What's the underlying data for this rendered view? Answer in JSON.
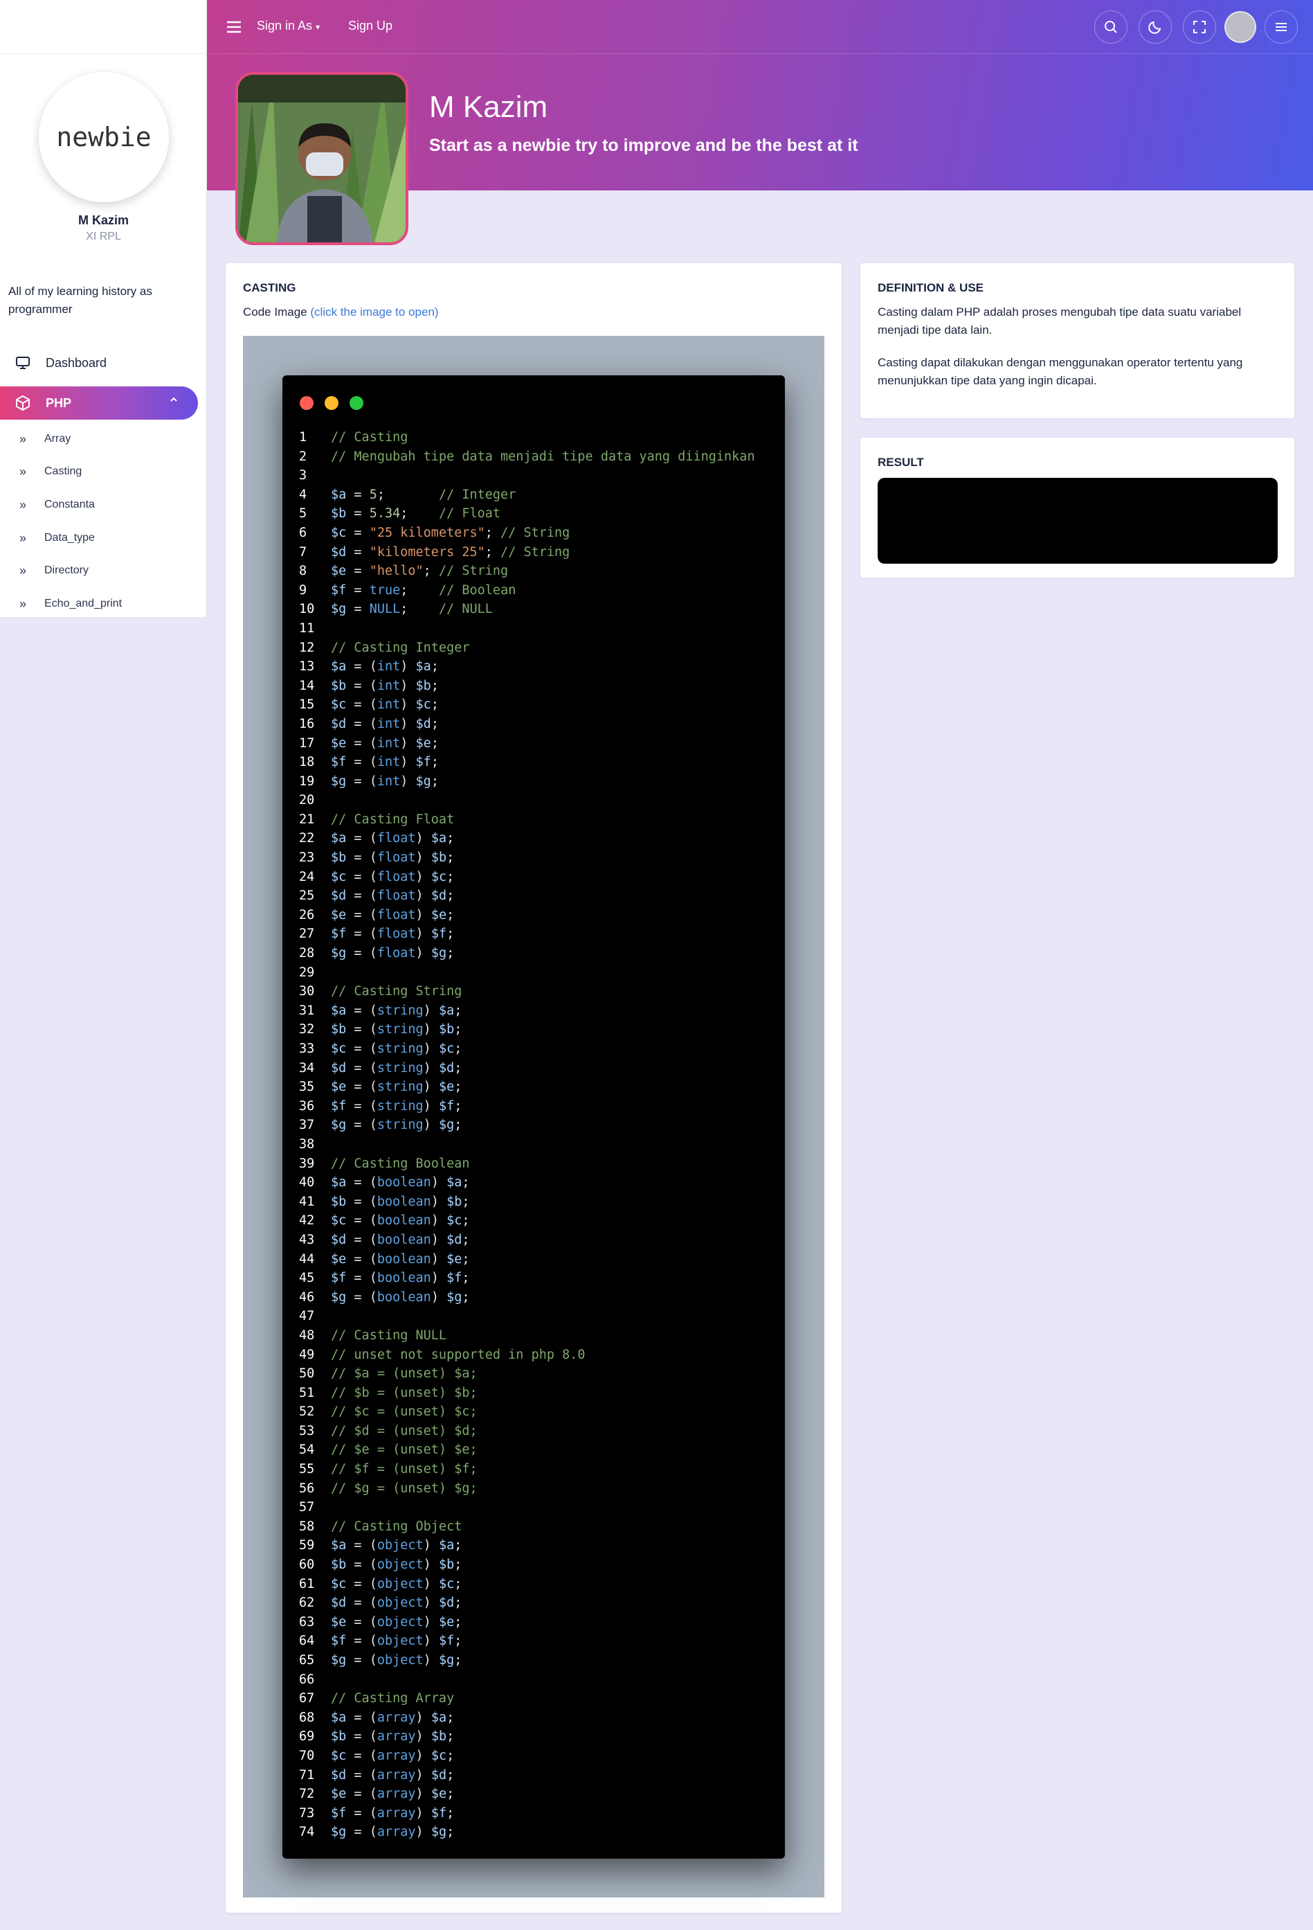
{
  "sidebar": {
    "logo_text": "newbie",
    "user_name": "M Kazim",
    "user_class": "XI RPL",
    "tagline": "All of my learning history as programmer",
    "nav": {
      "dashboard": "Dashboard",
      "php": "PHP"
    },
    "sub_items": [
      "Array",
      "Casting",
      "Constanta",
      "Data_type",
      "Directory",
      "Echo_and_print"
    ]
  },
  "topbar": {
    "signin_label": "Sign in As",
    "signup_label": "Sign Up"
  },
  "profile": {
    "name": "M Kazim",
    "tagline": "Start as a newbie try to improve and be the best at it"
  },
  "casting_card": {
    "title": "CASTING",
    "code_image_label": "Code Image",
    "code_image_link": "(click the image to open)"
  },
  "definition_card": {
    "title": "DEFINITION & USE",
    "paragraph1": "Casting dalam PHP adalah proses mengubah tipe data suatu variabel menjadi tipe data lain.",
    "paragraph2": "Casting dapat dilakukan dengan menggunakan operator tertentu yang menunjukkan tipe data yang ingin dicapai."
  },
  "result_card": {
    "title": "RESULT"
  },
  "code": {
    "lines": [
      "// Casting",
      "// Mengubah tipe data menjadi tipe data yang diinginkan",
      "",
      "$a = 5;       // Integer",
      "$b = 5.34;    // Float",
      "$c = \"25 kilometers\"; // String",
      "$d = \"kilometers 25\"; // String",
      "$e = \"hello\"; // String",
      "$f = true;    // Boolean",
      "$g = NULL;    // NULL",
      "",
      "// Casting Integer",
      "$a = (int) $a;",
      "$b = (int) $b;",
      "$c = (int) $c;",
      "$d = (int) $d;",
      "$e = (int) $e;",
      "$f = (int) $f;",
      "$g = (int) $g;",
      "",
      "// Casting Float",
      "$a = (float) $a;",
      "$b = (float) $b;",
      "$c = (float) $c;",
      "$d = (float) $d;",
      "$e = (float) $e;",
      "$f = (float) $f;",
      "$g = (float) $g;",
      "",
      "// Casting String",
      "$a = (string) $a;",
      "$b = (string) $b;",
      "$c = (string) $c;",
      "$d = (string) $d;",
      "$e = (string) $e;",
      "$f = (string) $f;",
      "$g = (string) $g;",
      "",
      "// Casting Boolean",
      "$a = (boolean) $a;",
      "$b = (boolean) $b;",
      "$c = (boolean) $c;",
      "$d = (boolean) $d;",
      "$e = (boolean) $e;",
      "$f = (boolean) $f;",
      "$g = (boolean) $g;",
      "",
      "// Casting NULL",
      "// unset not supported in php 8.0",
      "// $a = (unset) $a;",
      "// $b = (unset) $b;",
      "// $c = (unset) $c;",
      "// $d = (unset) $d;",
      "// $e = (unset) $e;",
      "// $f = (unset) $f;",
      "// $g = (unset) $g;",
      "",
      "// Casting Object",
      "$a = (object) $a;",
      "$b = (object) $b;",
      "$c = (object) $c;",
      "$d = (object) $d;",
      "$e = (object) $e;",
      "$f = (object) $f;",
      "$g = (object) $g;",
      "",
      "// Casting Array",
      "$a = (array) $a;",
      "$b = (array) $b;",
      "$c = (array) $c;",
      "$d = (array) $d;",
      "$e = (array) $e;",
      "$f = (array) $f;",
      "$g = (array) $g;"
    ]
  },
  "colors": {
    "accent_pink": "#e4407a",
    "accent_purple": "#6a4ee0",
    "link": "#3a78d8",
    "page_bg": "#e9e6f7"
  },
  "icons": {
    "topbar": [
      "search-icon",
      "moon-icon",
      "fullscreen-icon",
      "menu-icon"
    ],
    "nav": [
      "monitor-icon",
      "cube-icon",
      "chevron-up-icon",
      "double-chevron-right-icon"
    ]
  }
}
